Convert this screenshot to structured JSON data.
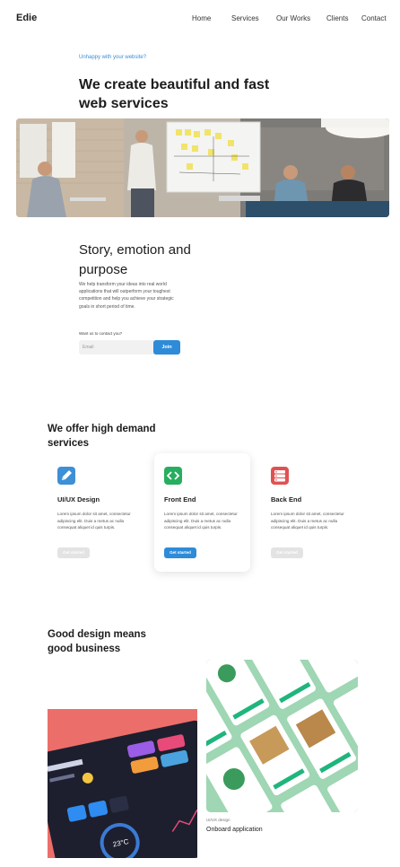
{
  "brand": {
    "logo": "Edie"
  },
  "nav": {
    "items": [
      "Home",
      "Services",
      "Our Works",
      "Clients",
      "Contact"
    ]
  },
  "hero": {
    "tagline": "Unhappy with your website?",
    "title": "We create beautiful and fast web services"
  },
  "story": {
    "title": "Story, emotion and purpose",
    "text": "We help transform your ideas into real world applications that will outperform your toughest competition and help you achieve your strategic goals in short period of time.",
    "contact_label": "Want us to contact you?",
    "email_placeholder": "Email",
    "join_label": "Join"
  },
  "services": {
    "title": "We offer high demand services",
    "items": [
      {
        "name": "UI/UX Design",
        "desc": "Lorem ipsum dolor sit amet, consectetur adipiscing elit. Duis a metus ac nulla consequat aliquet id quis turpis.",
        "button": "Get started",
        "icon": "pencil-icon",
        "color": "#3d8fd6"
      },
      {
        "name": "Front End",
        "desc": "Lorem ipsum dolor sit amet, consectetur adipiscing elit. Duis a metus ac nulla consequat aliquet id quis turpis.",
        "button": "Get started",
        "icon": "code-icon",
        "color": "#27ae60"
      },
      {
        "name": "Back End",
        "desc": "Lorem ipsum dolor sit amet, consectetur adipiscing elit. Duis a metus ac nulla consequat aliquet id quis turpis.",
        "button": "Get started",
        "icon": "server-icon",
        "color": "#e05252"
      }
    ]
  },
  "business": {
    "title": "Good design means good business",
    "project": {
      "tag": "UI/UX design",
      "name": "Onboard application"
    }
  },
  "colors": {
    "accent": "#2e8bd8",
    "muted_button": "#e3e3e3",
    "coral": "#ec6e6a",
    "mint": "#9fd6b3"
  }
}
